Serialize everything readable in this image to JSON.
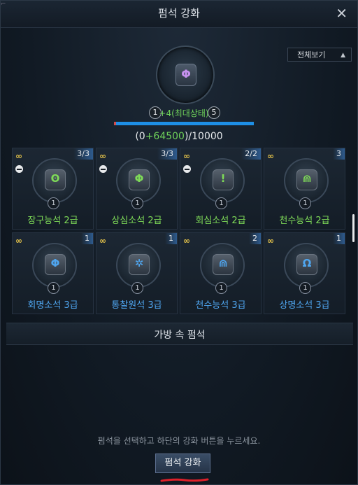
{
  "window": {
    "title": "펌석 강화",
    "close_icon": "close-icon"
  },
  "header": {
    "view_all_label": "전체보기"
  },
  "main_gem": {
    "level_current": "1",
    "level_next": "5",
    "status": "+4(최대상태)",
    "exp_prefix": "(0",
    "exp_gain": "+64500",
    "exp_suffix": ")/10000",
    "progress_fraction": 1.0,
    "stone_color": "#c792f0"
  },
  "gems": [
    {
      "name": "장구능석 2급",
      "count": "3/3",
      "level": "1",
      "equipped": true,
      "name_color": "#7fdc58",
      "glyph": "ʘ",
      "glyph_color": "#7fdc58"
    },
    {
      "name": "상심소석 2급",
      "count": "3/3",
      "level": "1",
      "equipped": true,
      "name_color": "#7fdc58",
      "glyph": "Φ",
      "glyph_color": "#7fdc58"
    },
    {
      "name": "회심소석 2급",
      "count": "2/2",
      "level": "1",
      "equipped": true,
      "name_color": "#7fdc58",
      "glyph": "!",
      "glyph_color": "#7fdc58"
    },
    {
      "name": "천수능석 2급",
      "count": "3",
      "level": "1",
      "equipped": false,
      "name_color": "#7fdc58",
      "glyph": "⋒",
      "glyph_color": "#7fdc58"
    },
    {
      "name": "회명소석 3급",
      "count": "1",
      "level": "1",
      "equipped": false,
      "name_color": "#4fa6f0",
      "glyph": "Φ",
      "glyph_color": "#4fa6f0"
    },
    {
      "name": "통찰원석 3급",
      "count": "1",
      "level": "1",
      "equipped": false,
      "name_color": "#4fa6f0",
      "glyph": "✲",
      "glyph_color": "#4fa6f0"
    },
    {
      "name": "천수능석 3급",
      "count": "2",
      "level": "1",
      "equipped": false,
      "name_color": "#4fa6f0",
      "glyph": "⋒",
      "glyph_color": "#4fa6f0"
    },
    {
      "name": "상명소석 3급",
      "count": "1",
      "level": "1",
      "equipped": false,
      "name_color": "#4fa6f0",
      "glyph": "Ω",
      "glyph_color": "#4fa6f0"
    }
  ],
  "bag": {
    "title": "가방 속 펌석"
  },
  "footer": {
    "hint": "펌석을 선택하고 하단의 강화 버튼을 누르세요.",
    "enhance_button": "펌석 강화"
  },
  "colors": {
    "accent_blue": "#1e8fe6",
    "gain_green": "#6fd25a",
    "annotation_red": "#e0202a"
  }
}
